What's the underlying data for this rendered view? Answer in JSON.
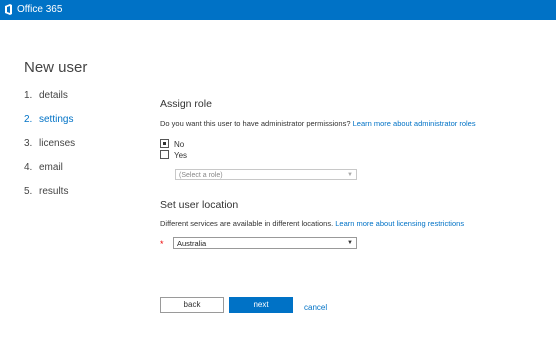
{
  "app": {
    "title": "Office 365"
  },
  "page": {
    "title": "New user"
  },
  "steps": [
    {
      "num": "1.",
      "label": "details"
    },
    {
      "num": "2.",
      "label": "settings"
    },
    {
      "num": "3.",
      "label": "licenses"
    },
    {
      "num": "4.",
      "label": "email"
    },
    {
      "num": "5.",
      "label": "results"
    }
  ],
  "active_step": "settings",
  "assign_role": {
    "heading": "Assign role",
    "question": "Do you want this user to have administrator permissions?",
    "link": "Learn more about administrator roles",
    "options": [
      {
        "label": "No",
        "checked": true
      },
      {
        "label": "Yes",
        "checked": false
      }
    ],
    "select_placeholder": "(Select a role)"
  },
  "location": {
    "heading": "Set user location",
    "description": "Different services are available in different locations.",
    "link": "Learn more about licensing restrictions",
    "required_mark": "*",
    "value": "Australia"
  },
  "buttons": {
    "back": "back",
    "next": "next",
    "cancel": "cancel"
  },
  "colors": {
    "brand": "#0072c6"
  }
}
